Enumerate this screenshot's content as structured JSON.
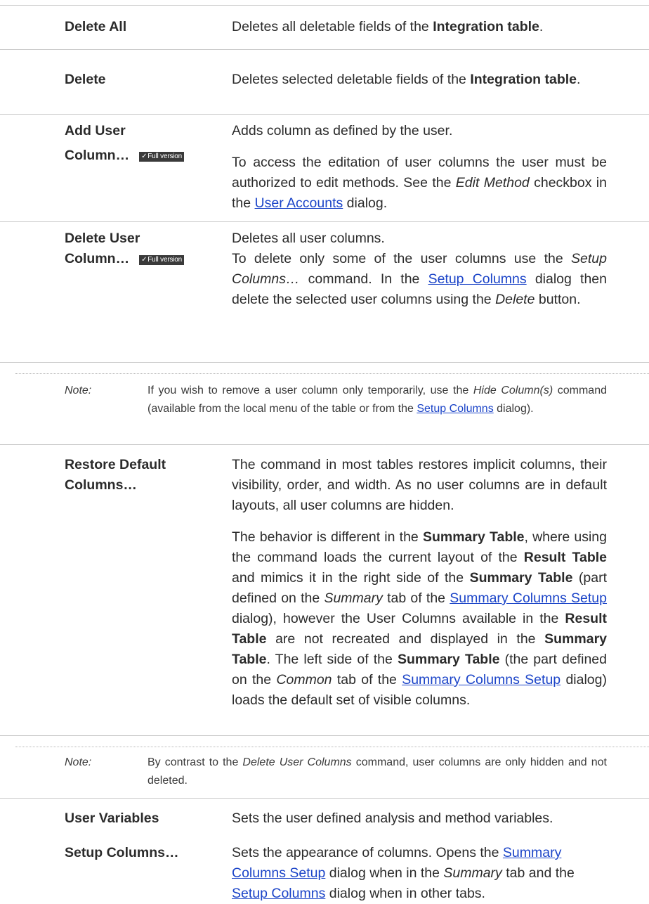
{
  "rows": {
    "delete_all": {
      "term": "Delete All",
      "d1": "Deletes all deletable fields of the ",
      "d2": "Integration table",
      "d3": "."
    },
    "delete": {
      "term": "Delete",
      "d1": "Deletes selected deletable fields of the ",
      "d2": "Integration table",
      "d3": "."
    },
    "add_user_column": {
      "term_line1": "Add User",
      "term_line2": "Column…",
      "badge": "Full version",
      "p1": "Adds column as defined by the user.",
      "p2a": "To access the editation of user columns the user must be authorized to edit methods. See the ",
      "p2b": "Edit Method",
      "p2c": " checkbox in the ",
      "p2link": "User Accounts",
      "p2d": " dialog."
    },
    "delete_user_column": {
      "term_line1": "Delete User",
      "term_line2": "Column…",
      "badge": "Full version",
      "p1": "Deletes all user columns.",
      "p2a": "To delete only some of the user columns use the ",
      "p2b": "Setup Columns…",
      "p2c": " command. In the ",
      "p2link": "Setup Columns",
      "p2d": " dialog then delete the selected user columns using the ",
      "p2e": "Delete",
      "p2f": " button."
    },
    "note1": {
      "label": "Note:",
      "a": "If you wish to remove a user column only temporarily, use the ",
      "b": "Hide Column(s)",
      "c": " command (available from the local menu of the table or from the ",
      "link": "Setup Columns",
      "d": " dialog)."
    },
    "restore_default": {
      "term_line1": "Restore Default",
      "term_line2": "Columns…",
      "p1": "The command in most tables restores implicit columns, their visibility, order, and width. As no user columns are in default layouts, all user columns are hidden.",
      "p2a": "The behavior is different in the ",
      "p2b": "Summary Table",
      "p2c": ", where using the command loads the current layout of the ",
      "p2d": "Result Table",
      "p2e": " and mimics it in the right side of the ",
      "p2f": "Summary Table",
      "p2g": " (part defined on the ",
      "p2h": "Summary",
      "p2i": " tab of the ",
      "p2link1": "Summary Columns Setup",
      "p2j": " dialog), however the User Columns available in the ",
      "p2k": "Result Table",
      "p2l": " are not recreated and displayed in the ",
      "p2m": "Summary Table",
      "p2n": ". The left side of the ",
      "p2o": "Summary Table",
      "p2p": " (the part defined on the ",
      "p2q": "Common",
      "p2r": " tab of the ",
      "p2link2": "Summary Columns Setup",
      "p2s": " dialog) loads the default set of visible columns."
    },
    "note2": {
      "label": "Note:",
      "a": "By contrast to the ",
      "b": "Delete User Columns",
      "c": " command, user columns are only hidden and not deleted."
    },
    "user_variables": {
      "term": "User Variables",
      "d": "Sets the user defined analysis and method variables."
    },
    "setup_columns": {
      "term": "Setup Columns…",
      "a": "Sets the appearance of columns. Opens the ",
      "link1": "Summary Columns Setup",
      "b": " dialog when in the ",
      "c": "Summary",
      "d": " tab and the ",
      "link2": "Setup Columns",
      "e": " dialog when in other tabs."
    }
  }
}
